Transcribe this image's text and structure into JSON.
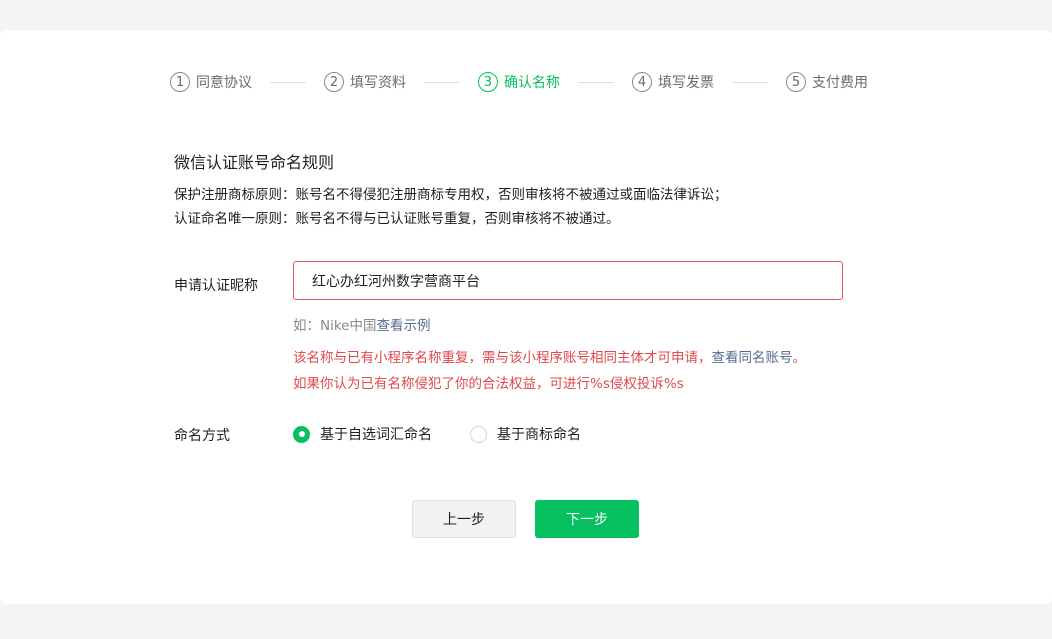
{
  "steps": [
    {
      "num": "1",
      "label": "同意协议"
    },
    {
      "num": "2",
      "label": "填写资料"
    },
    {
      "num": "3",
      "label": "确认名称",
      "active": true
    },
    {
      "num": "4",
      "label": "填写发票"
    },
    {
      "num": "5",
      "label": "支付费用"
    }
  ],
  "rules": {
    "title": "微信认证账号命名规则",
    "line1": "保护注册商标原则：账号名不得侵犯注册商标专用权，否则审核将不被通过或面临法律诉讼；",
    "line2": "认证命名唯一原则：账号名不得与已认证账号重复，否则审核将不被通过。"
  },
  "form": {
    "nickname_label": "申请认证昵称",
    "nickname_value": "红心办红河州数字营商平台",
    "hint_prefix": "如：Nike中国",
    "hint_link": "查看示例",
    "error_line1_text": "该名称与已有小程序名称重复，需与该小程序账号相同主体才可申请，",
    "error_line1_link": "查看同名账号",
    "error_line1_end": "。",
    "error_line2": "如果你认为已有名称侵犯了你的合法权益，可进行%s侵权投诉%s",
    "method_label": "命名方式",
    "method_options": [
      {
        "label": "基于自选词汇命名",
        "checked": true
      },
      {
        "label": "基于商标命名",
        "checked": false
      }
    ]
  },
  "buttons": {
    "prev": "上一步",
    "next": "下一步"
  },
  "colors": {
    "accent": "#07c160",
    "error": "#e0494a",
    "link": "#576b95"
  }
}
